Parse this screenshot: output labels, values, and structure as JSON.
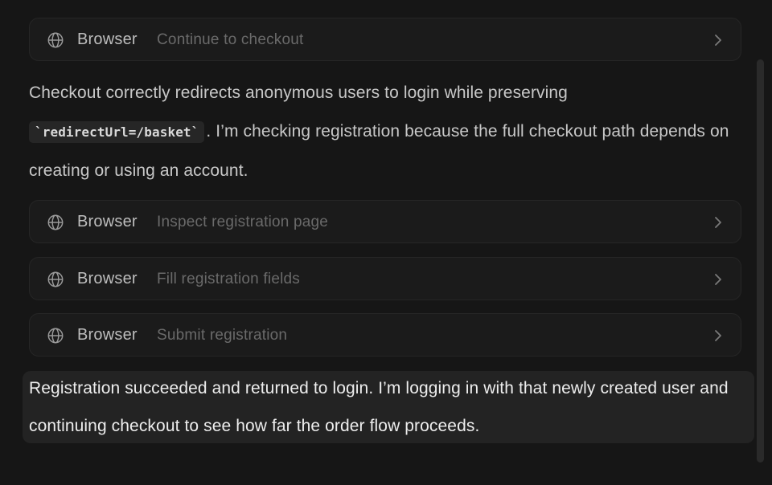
{
  "steps": [
    {
      "tool": "Browser",
      "desc": "Continue to checkout"
    },
    {
      "tool": "Browser",
      "desc": "Inspect registration page"
    },
    {
      "tool": "Browser",
      "desc": "Fill registration fields"
    },
    {
      "tool": "Browser",
      "desc": "Submit registration"
    }
  ],
  "messages": {
    "first": {
      "before": "Checkout correctly redirects anonymous users to login while preserving",
      "code": "`redirectUrl=/basket`",
      "after": ". I’m checking registration because the full checkout path depends on creating or using an account."
    },
    "second": "Registration succeeded and returned to login. I’m logging in with that newly created user and continuing checkout to see how far the order flow proceeds."
  },
  "icons": {
    "step": "globe-icon",
    "expand": "chevron-right-icon"
  },
  "colors": {
    "background": "#161616",
    "step_card": "#1b1b1b",
    "highlight": "#232323"
  }
}
